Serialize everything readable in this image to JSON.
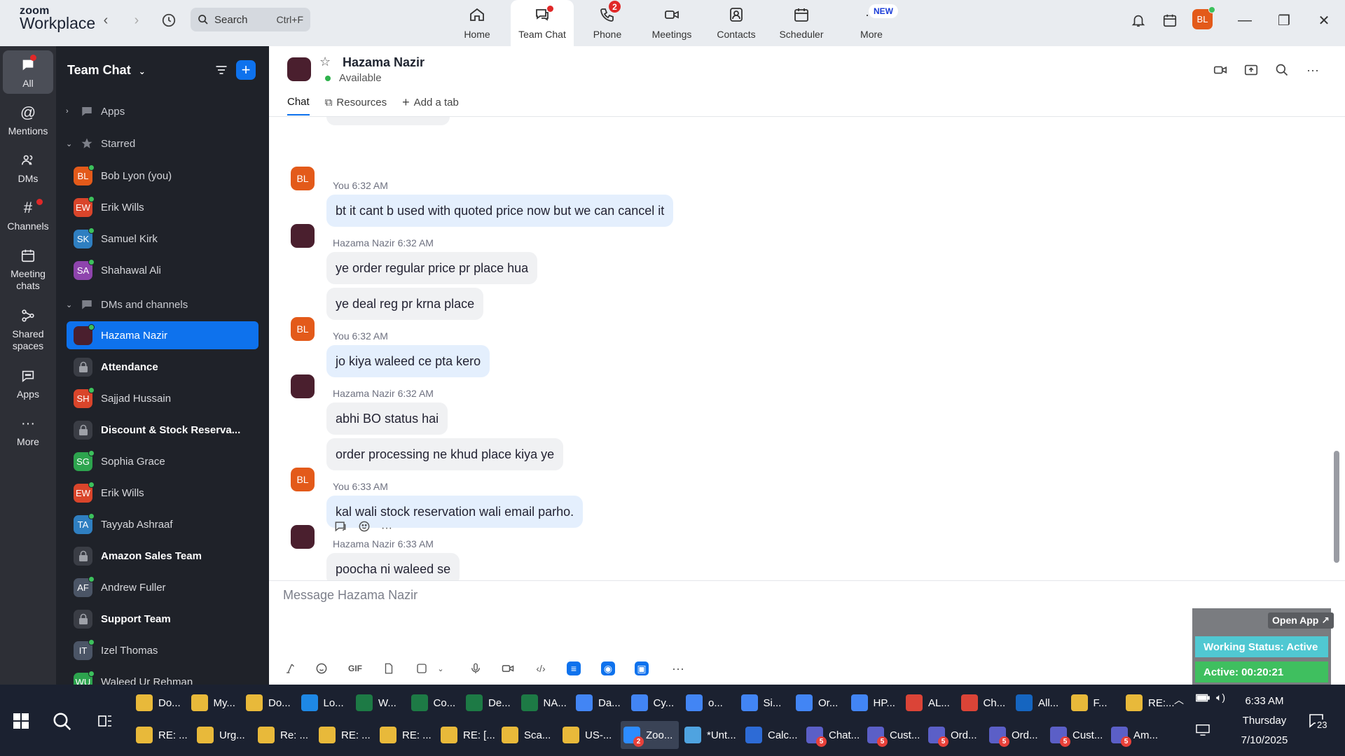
{
  "app": {
    "logo_line1": "zoom",
    "logo_line2": "Workplace",
    "search_placeholder": "Search",
    "search_shortcut": "Ctrl+F",
    "user_initials": "BL"
  },
  "tabs": [
    {
      "label": "Home"
    },
    {
      "label": "Team Chat"
    },
    {
      "label": "Phone",
      "badge": "2"
    },
    {
      "label": "Meetings"
    },
    {
      "label": "Contacts"
    },
    {
      "label": "Scheduler"
    },
    {
      "label": "More",
      "badge": "NEW"
    }
  ],
  "rail": [
    {
      "label": "All"
    },
    {
      "label": "Mentions"
    },
    {
      "label": "DMs"
    },
    {
      "label": "Channels"
    },
    {
      "label": "Meeting chats"
    },
    {
      "label": "Shared spaces"
    },
    {
      "label": "Apps"
    },
    {
      "label": "More"
    }
  ],
  "sidebar": {
    "title": "Team Chat",
    "sections": {
      "apps": "Apps",
      "starred": "Starred",
      "dms": "DMs and channels"
    },
    "starred": [
      {
        "initials": "BL",
        "name": "Bob Lyon (you)",
        "color": "#e35a1a"
      },
      {
        "initials": "EW",
        "name": "Erik Wills",
        "color": "#d9452b"
      },
      {
        "initials": "SK",
        "name": "Samuel Kirk",
        "color": "#2f7fc1"
      },
      {
        "initials": "SA",
        "name": "Shahawal Ali",
        "color": "#8e44ad"
      }
    ],
    "dms": [
      {
        "initials": "",
        "name": "Hazama Nazir",
        "color": "#4a1f2e",
        "active": true
      },
      {
        "initials": "",
        "name": "Attendance",
        "lock": true
      },
      {
        "initials": "SH",
        "name": "Sajjad Hussain",
        "color": "#d9452b"
      },
      {
        "initials": "",
        "name": "Discount & Stock Reserva...",
        "lock": true
      },
      {
        "initials": "SG",
        "name": "Sophia Grace",
        "color": "#2da44e"
      },
      {
        "initials": "EW",
        "name": "Erik Wills",
        "color": "#d9452b"
      },
      {
        "initials": "TA",
        "name": "Tayyab Ashraaf",
        "color": "#2f7fc1"
      },
      {
        "initials": "",
        "name": "Amazon Sales Team",
        "lock": true
      },
      {
        "initials": "AF",
        "name": "Andrew Fuller",
        "color": "#4b5566"
      },
      {
        "initials": "",
        "name": "Support Team",
        "lock": true
      },
      {
        "initials": "IT",
        "name": "Izel Thomas",
        "color": "#4b5566"
      },
      {
        "initials": "WU",
        "name": "Waleed Ur Rehman",
        "color": "#2da44e"
      }
    ]
  },
  "chat": {
    "name": "Hazama Nazir",
    "status": "Available",
    "tabs": [
      "Chat",
      "Resources",
      "Add a tab"
    ],
    "messages": [
      {
        "meta": "You 6:32 AM",
        "text": "bt it cant b used with quoted price now but we can cancel it",
        "me": true
      },
      {
        "meta": "Hazama Nazir 6:32 AM",
        "text": "ye order regular price pr place hua",
        "me": false
      },
      {
        "meta": "",
        "text": "ye deal reg pr krna place",
        "me": false
      },
      {
        "meta": "You 6:32 AM",
        "text": "jo kiya waleed ce pta kero",
        "me": true
      },
      {
        "meta": "Hazama Nazir 6:32 AM",
        "text": "abhi BO status hai",
        "me": false
      },
      {
        "meta": "",
        "text": "order processing ne khud place kiya ye",
        "me": false
      },
      {
        "meta": "You 6:33 AM",
        "text": "kal wali stock reservation wali email parho.",
        "me": true
      },
      {
        "meta": "Hazama Nazir 6:33 AM",
        "text": "poocha ni waleed se",
        "me": false
      }
    ],
    "compose_placeholder": "Message Hazama Nazir"
  },
  "status_widget": {
    "open_app": "Open App ↗",
    "working_status": "Working Status: Active",
    "active_timer": "Active: 00:20:21"
  },
  "taskbar": {
    "row1": [
      {
        "label": "Do...",
        "icon": "folder",
        "color": "#e8b93a"
      },
      {
        "label": "My...",
        "icon": "folder",
        "color": "#e8b93a"
      },
      {
        "label": "Do...",
        "icon": "folder",
        "color": "#e8b93a"
      },
      {
        "label": "Lo...",
        "icon": "edge",
        "color": "#1e88e5"
      },
      {
        "label": "W...",
        "icon": "excel",
        "color": "#1d7a45"
      },
      {
        "label": "Co...",
        "icon": "excel",
        "color": "#1d7a45"
      },
      {
        "label": "De...",
        "icon": "excel",
        "color": "#1d7a45"
      },
      {
        "label": "NA...",
        "icon": "excel",
        "color": "#1d7a45"
      },
      {
        "label": "Da...",
        "icon": "chrome",
        "color": "#4285f4"
      },
      {
        "label": "Cy...",
        "icon": "chrome",
        "color": "#4285f4"
      },
      {
        "label": "o...",
        "icon": "chrome",
        "color": "#4285f4"
      },
      {
        "label": "Si...",
        "icon": "chrome",
        "color": "#4285f4"
      },
      {
        "label": "Or...",
        "icon": "chrome",
        "color": "#4285f4"
      },
      {
        "label": "HP...",
        "icon": "chrome",
        "color": "#4285f4"
      },
      {
        "label": "AL...",
        "icon": "chrome",
        "color": "#db4437"
      },
      {
        "label": "Ch...",
        "icon": "chrome",
        "color": "#db4437"
      },
      {
        "label": "All...",
        "icon": "outlook",
        "color": "#1565c0"
      },
      {
        "label": "F...",
        "icon": "mail",
        "color": "#e8b93a"
      },
      {
        "label": "RE:...",
        "icon": "mail",
        "color": "#e8b93a"
      }
    ],
    "row2": [
      {
        "label": "RE: ...",
        "icon": "mail",
        "color": "#e8b93a"
      },
      {
        "label": "Urg...",
        "icon": "mail",
        "color": "#e8b93a"
      },
      {
        "label": "Re: ...",
        "icon": "mail",
        "color": "#e8b93a"
      },
      {
        "label": "RE: ...",
        "icon": "mail",
        "color": "#e8b93a"
      },
      {
        "label": "RE: ...",
        "icon": "mail",
        "color": "#e8b93a"
      },
      {
        "label": "RE: [...",
        "icon": "mail",
        "color": "#e8b93a"
      },
      {
        "label": "Sca...",
        "icon": "mail",
        "color": "#e8b93a"
      },
      {
        "label": "US-...",
        "icon": "mail",
        "color": "#e8b93a"
      },
      {
        "label": "Zoo...",
        "icon": "zoom",
        "color": "#2d8cff",
        "badge": "2"
      },
      {
        "label": "*Unt...",
        "icon": "notepad",
        "color": "#4fa3e0"
      },
      {
        "label": "Calc...",
        "icon": "calc",
        "color": "#2d6bd6"
      },
      {
        "label": "Chat...",
        "icon": "teams",
        "color": "#5b5fc7",
        "badge": "5"
      },
      {
        "label": "Cust...",
        "icon": "teams",
        "color": "#5b5fc7",
        "badge": "5"
      },
      {
        "label": "Ord...",
        "icon": "teams",
        "color": "#5b5fc7",
        "badge": "5"
      },
      {
        "label": "Ord...",
        "icon": "teams",
        "color": "#5b5fc7",
        "badge": "5"
      },
      {
        "label": "Cust...",
        "icon": "teams",
        "color": "#5b5fc7",
        "badge": "5"
      },
      {
        "label": "Am...",
        "icon": "teams",
        "color": "#5b5fc7",
        "badge": "5"
      }
    ],
    "time": "6:33 AM",
    "day": "Thursday",
    "date": "7/10/2025",
    "notif_count": "23"
  }
}
